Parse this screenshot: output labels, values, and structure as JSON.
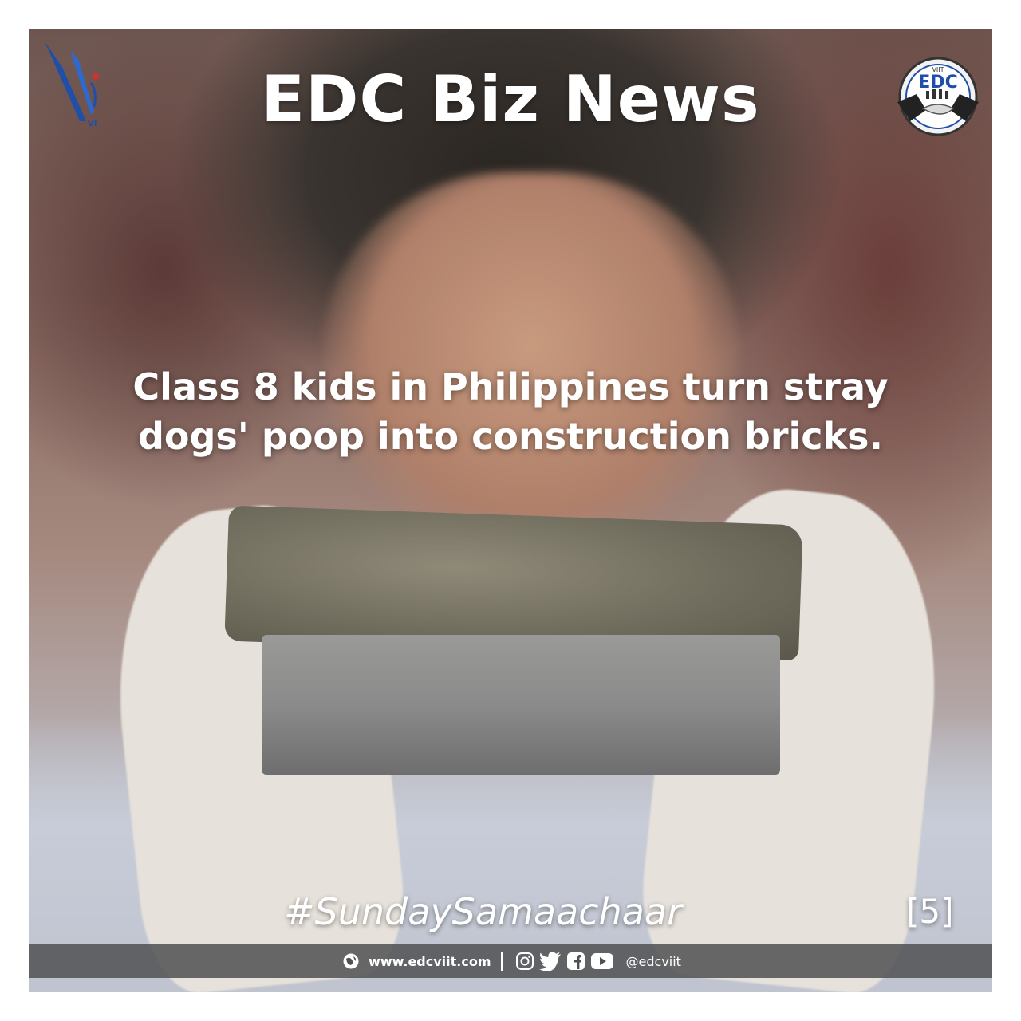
{
  "header": {
    "title": "EDC Biz News",
    "left_logo_text": "VI",
    "right_logo_text": "EDC",
    "right_logo_subtext": "VIIT"
  },
  "headline": {
    "line1": "Class 8 kids in Philippines  turn stray",
    "line2": "dogs' poop into construction bricks."
  },
  "hashtag": "#SundaySamaachaar",
  "page_number": "[5]",
  "footer": {
    "website": "www.edcviit.com",
    "handle": "@edcviit",
    "icons": [
      "globe-icon",
      "instagram-icon",
      "twitter-icon",
      "facebook-icon",
      "youtube-icon"
    ]
  },
  "colors": {
    "text": "#ffffff",
    "footer_bar": "#505052",
    "logo_blue": "#1f4fa8"
  }
}
